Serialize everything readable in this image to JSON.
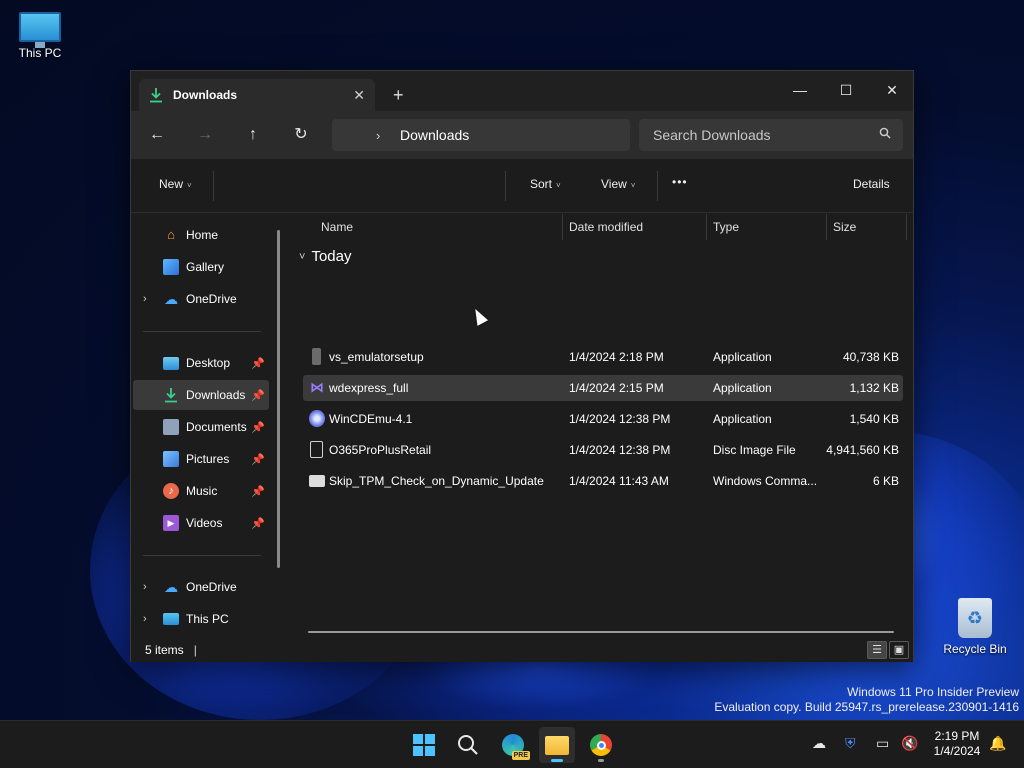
{
  "desktop": {
    "this_pc_label": "This PC",
    "recycle_bin_label": "Recycle Bin",
    "watermark_line1": "Windows 11 Pro Insider Preview",
    "watermark_line2": "Evaluation copy. Build 25947.rs_prerelease.230901-1416"
  },
  "window": {
    "tab_title": "Downloads",
    "tab_icon": "download-icon",
    "tab_close": "✕",
    "new_tab": "+",
    "controls": {
      "minimize": "—",
      "maximize": "☐",
      "close": "✕"
    }
  },
  "nav": {
    "back": "←",
    "forward": "→",
    "up": "↑",
    "refresh": "↻",
    "separator": "›",
    "breadcrumb": "Downloads",
    "search_placeholder": "Search Downloads",
    "search_icon": "search-icon"
  },
  "toolbar": {
    "new_label": "New",
    "sort_label": "Sort",
    "view_label": "View",
    "more_label": "•••",
    "details_label": "Details",
    "dropdown_chevron": "˅"
  },
  "sidebar": {
    "items": [
      {
        "label": "Home",
        "icon": "home-icon",
        "expander": "",
        "pinned": false
      },
      {
        "label": "Gallery",
        "icon": "gallery-icon",
        "expander": "",
        "pinned": false
      },
      {
        "label": "OneDrive",
        "icon": "cloud-icon",
        "expander": "›",
        "pinned": false
      },
      {
        "label": "Desktop",
        "icon": "desktop-folder-icon",
        "expander": "",
        "pinned": true
      },
      {
        "label": "Downloads",
        "icon": "download-icon",
        "expander": "",
        "pinned": true,
        "selected": true
      },
      {
        "label": "Documents",
        "icon": "documents-icon",
        "expander": "",
        "pinned": true
      },
      {
        "label": "Pictures",
        "icon": "pictures-icon",
        "expander": "",
        "pinned": true
      },
      {
        "label": "Music",
        "icon": "music-icon",
        "expander": "",
        "pinned": true
      },
      {
        "label": "Videos",
        "icon": "videos-icon",
        "expander": "",
        "pinned": true
      },
      {
        "label": "OneDrive",
        "icon": "cloud-icon",
        "expander": "›",
        "pinned": false
      },
      {
        "label": "This PC",
        "icon": "pc-icon",
        "expander": "›",
        "pinned": false
      }
    ],
    "pin_glyph": "📌"
  },
  "files": {
    "columns": [
      "Name",
      "Date modified",
      "Type",
      "Size"
    ],
    "group_label": "Today",
    "group_chevron": "˅",
    "rows": [
      {
        "name": "vs_emulatorsetup",
        "date": "1/4/2024 2:18 PM",
        "type": "Application",
        "size": "40,738 KB",
        "icon": "installer-icon"
      },
      {
        "name": "wdexpress_full",
        "date": "1/4/2024 2:15 PM",
        "type": "Application",
        "size": "1,132 KB",
        "icon": "visual-studio-icon"
      },
      {
        "name": "WinCDEmu-4.1",
        "date": "1/4/2024 12:38 PM",
        "type": "Application",
        "size": "1,540 KB",
        "icon": "wincdemu-icon"
      },
      {
        "name": "O365ProPlusRetail",
        "date": "1/4/2024 12:38 PM",
        "type": "Disc Image File",
        "size": "4,941,560 KB",
        "icon": "disc-image-icon"
      },
      {
        "name": "Skip_TPM_Check_on_Dynamic_Update",
        "date": "1/4/2024 11:43 AM",
        "type": "Windows Comma...",
        "size": "6 KB",
        "icon": "script-icon"
      }
    ]
  },
  "status": {
    "item_count": "5 items",
    "caret": "|",
    "details_view": "☰",
    "tiles_view": "▣"
  },
  "taskbar": {
    "apps": [
      "start-icon",
      "search-icon",
      "edge-icon",
      "file-explorer-icon",
      "chrome-icon"
    ],
    "edge_badge": "PRE",
    "tray_icons": [
      "cloud-offline-icon",
      "security-icon",
      "network-icon",
      "volume-mute-icon"
    ],
    "time": "2:19 PM",
    "date": "1/4/2024",
    "notification_icon": "bell-icon"
  },
  "colors": {
    "accent": "#4cc2ff",
    "window_bg": "#1c1c1c",
    "selection": "#3a3a3a",
    "download_green": "#3ccf8e"
  }
}
